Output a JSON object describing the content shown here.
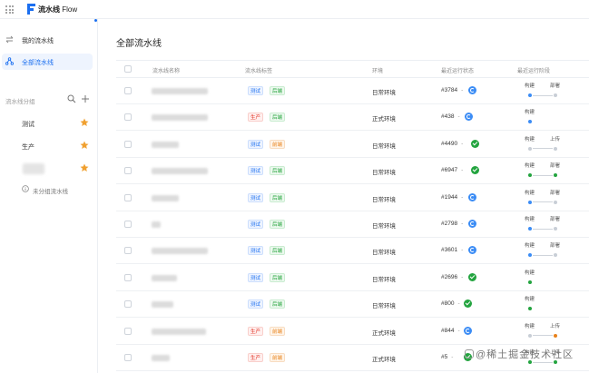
{
  "header": {
    "app_title": "流水线",
    "app_title_en": "Flow"
  },
  "sidebar": {
    "nav": [
      {
        "label": "我的流水线",
        "icon": "swap-icon",
        "active": false
      },
      {
        "label": "全部流水线",
        "icon": "pipeline-icon",
        "active": true
      }
    ],
    "group_title": "流水线分组",
    "groups": [
      {
        "label": "测试",
        "starred": true
      },
      {
        "label": "生产",
        "starred": true
      },
      {
        "label": "",
        "starred": true
      }
    ],
    "ungrouped": "未分组流水线"
  },
  "main": {
    "title": "全部流水线",
    "columns": [
      "流水线名称",
      "流水线标签",
      "环境",
      "最近运行状态",
      "最近运行阶段"
    ],
    "rows": [
      {
        "tags": [
          "测试",
          "后端"
        ],
        "env": "日常环境",
        "build": "#3784",
        "status": "running",
        "stages": [
          "构建",
          "部署"
        ],
        "stage_colors": [
          "#3b8cf5",
          "#c8ced6"
        ]
      },
      {
        "tags": [
          "生产",
          "后端"
        ],
        "env": "正式环境",
        "build": "#438",
        "status": "running",
        "stages": [
          "构建"
        ],
        "stage_colors": [
          "#3b8cf5"
        ]
      },
      {
        "tags": [
          "测试",
          "前端"
        ],
        "env": "日常环境",
        "build": "#4490",
        "status": "success",
        "stages": [
          "构建",
          "上传"
        ],
        "stage_colors": [
          "#c8ced6",
          "#c8ced6"
        ]
      },
      {
        "tags": [
          "测试",
          "后端"
        ],
        "env": "日常环境",
        "build": "#6947",
        "status": "success",
        "stages": [
          "构建",
          "部署"
        ],
        "stage_colors": [
          "#23a43f",
          "#23a43f"
        ]
      },
      {
        "tags": [
          "测试",
          "后端"
        ],
        "env": "日常环境",
        "build": "#1944",
        "status": "running",
        "stages": [
          "构建",
          "部署"
        ],
        "stage_colors": [
          "#3b8cf5",
          "#c8ced6"
        ]
      },
      {
        "tags": [
          "测试",
          "后端"
        ],
        "env": "日常环境",
        "build": "#2798",
        "status": "running",
        "stages": [
          "构建",
          "部署"
        ],
        "stage_colors": [
          "#3b8cf5",
          "#c8ced6"
        ]
      },
      {
        "tags": [
          "测试",
          "后端"
        ],
        "env": "日常环境",
        "build": "#3601",
        "status": "running",
        "stages": [
          "构建",
          "部署"
        ],
        "stage_colors": [
          "#3b8cf5",
          "#c8ced6"
        ]
      },
      {
        "tags": [
          "测试",
          "后端"
        ],
        "env": "日常环境",
        "build": "#2696",
        "status": "success",
        "stages": [
          "构建"
        ],
        "stage_colors": [
          "#23a43f"
        ]
      },
      {
        "tags": [
          "测试",
          "后端"
        ],
        "env": "日常环境",
        "build": "#800",
        "status": "success",
        "stages": [
          "构建"
        ],
        "stage_colors": [
          "#23a43f"
        ]
      },
      {
        "tags": [
          "生产",
          "前端"
        ],
        "env": "正式环境",
        "build": "#844",
        "status": "running",
        "stages": [
          "构建",
          "上传"
        ],
        "stage_colors": [
          "#c8ced6",
          "#e8821b"
        ]
      },
      {
        "tags": [
          "生产",
          "前端"
        ],
        "env": "正式环境",
        "build": "#5",
        "status": "success",
        "stages": [
          "构建",
          "上传"
        ],
        "stage_colors": [
          "#23a43f",
          "#23a43f"
        ]
      }
    ]
  },
  "watermark": "@稀土掘金技术社区"
}
